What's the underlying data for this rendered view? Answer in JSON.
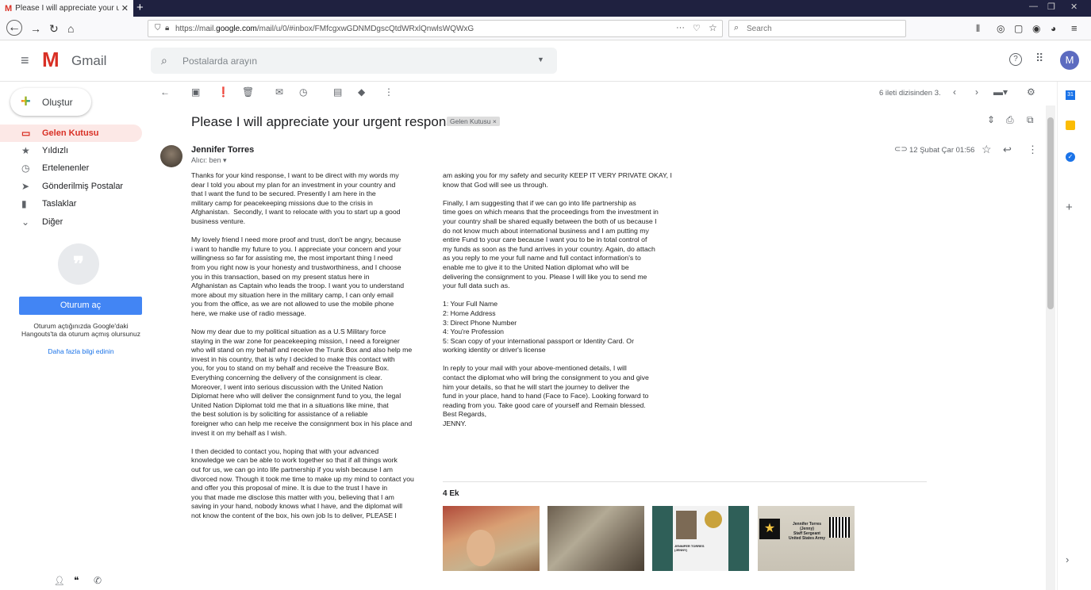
{
  "browser": {
    "tab_title": "Please I will appreciate your urg",
    "tab_close": "✕",
    "new_tab": "+",
    "url_prefix": "https://mail.",
    "url_domain": "google.com",
    "url_rest": "/mail/u/0/#inbox/FMfcgxwGDNMDgscQtdWRxlQnwlsWQWxG",
    "search_placeholder": "Search",
    "more_icon": "···"
  },
  "gmail": {
    "logo_text": "Gmail",
    "search_placeholder": "Postalarda arayın",
    "avatar_letter": "M",
    "compose_label": "Oluştur",
    "nav": [
      {
        "label": "Gelen Kutusu",
        "icon": "inbox-icon"
      },
      {
        "label": "Yıldızlı",
        "icon": "star-icon"
      },
      {
        "label": "Ertelenenler",
        "icon": "clock-icon"
      },
      {
        "label": "Gönderilmiş Postalar",
        "icon": "send-icon"
      },
      {
        "label": "Taslaklar",
        "icon": "draft-icon"
      },
      {
        "label": "Diğer",
        "icon": "chevron-down-icon"
      }
    ],
    "signin_label": "Oturum aç",
    "hangouts_text": "Oturum açtığınızda Google'daki Hangouts'ta da oturum açmış olursunuz",
    "hangouts_link": "Daha fazla bilgi edinin",
    "pagination": "6 ileti dizisinden 3."
  },
  "message": {
    "subject": "Please I will appreciate your urgent response.",
    "label": "Gelen Kutusu ×",
    "sender": "Jennifer Torres",
    "to": "Alıcı: ben",
    "date": "12 Şubat Çar 01:56",
    "body_col1": "Thanks for your kind response, I want to be direct with my words my\ndear I told you about my plan for an investment in your country and\nthat I want the fund to be secured. Presently I am here in the\nmilitary camp for peacekeeping missions due to the crisis in\nAfghanistan.  Secondly, I want to relocate with you to start up a good\nbusiness venture.\n\nMy lovely friend I need more proof and trust, don't be angry, because\ni want to handle my future to you. I appreciate your concern and your\nwillingness so far for assisting me, the most important thing I need\nfrom you right now is your honesty and trustworthiness, and I choose\nyou in this transaction, based on my present status here in\nAfghanistan as Captain who leads the troop. I want you to understand\nmore about my situation here in the military camp, I can only email\nyou from the office, as we are not allowed to use the mobile phone\nhere, we make use of radio message.\n\nNow my dear due to my political situation as a U.S Military force\nstaying in the war zone for peacekeeping mission, I need a foreigner\nwho will stand on my behalf and receive the Trunk Box and also help me\ninvest in his country, that is why I decided to make this contact with\nyou, for you to stand on my behalf and receive the Treasure Box.\nEverything concerning the delivery of the consignment is clear.\nMoreover, I went into serious discussion with the United Nation\nDiplomat here who will deliver the consignment fund to you, the legal\nUnited Nation Diplomat told me that in a situations like mine, that\nthe best solution is by soliciting for assistance of a reliable\nforeigner who can help me receive the consignment box in his place and\ninvest it on my behalf as I wish.\n\nI then decided to contact you, hoping that with your advanced\nknowledge we can be able to work together so that if all things work\nout for us, we can go into life partnership if you wish because I am\ndivorced now. Though it took me time to make up my mind to contact you\nand offer you this proposal of mine. It is due to the trust I have in\nyou that made me disclose this matter with you, believing that I am\nsaving in your hand, nobody knows what I have, and the diplomat will\nnot know the content of the box, his own job Is to deliver, PLEASE I",
    "body_col2": "am asking you for my safety and security KEEP IT VERY PRIVATE OKAY, I\nknow that God will see us through.\n\nFinally, I am suggesting that if we can go into life partnership as\ntime goes on which means that the proceedings from the investment in\nyour country shall be shared equally between the both of us because I\ndo not know much about international business and I am putting my\nentire Fund to your care because I want you to be in total control of\nmy funds as soon as the fund arrives in your country. Again, do attach\nas you reply to me your full name and full contact information's to\nenable me to give it to the United Nation diplomat who will be\ndelivering the consignment to you. Please I will like you to send me\nyour full data such as.\n\n1: Your Full Name\n2: Home Address\n3: Direct Phone Number\n4: You're Profession\n5: Scan copy of your international passport or Identity Card. Or\nworking identity or driver's license\n\nIn reply to your mail with your above-mentioned details, I will\ncontact the diplomat who will bring the consignment to you and give\nhim your details, so that he will start the journey to deliver the\nfund in your place, hand to hand (Face to Face). Looking forward to\nreading from you. Take good care of yourself and Remain blessed.\nBest Regards,\nJENNY.",
    "attachments_title": "4 Ek",
    "card_name": "Jennifer Torres",
    "card_nick": "(Jenny)",
    "card_rank": "Staff Sergeant",
    "card_unit": "United States Army",
    "id_caption": "JENNIFER TORRES (JENNY)"
  }
}
